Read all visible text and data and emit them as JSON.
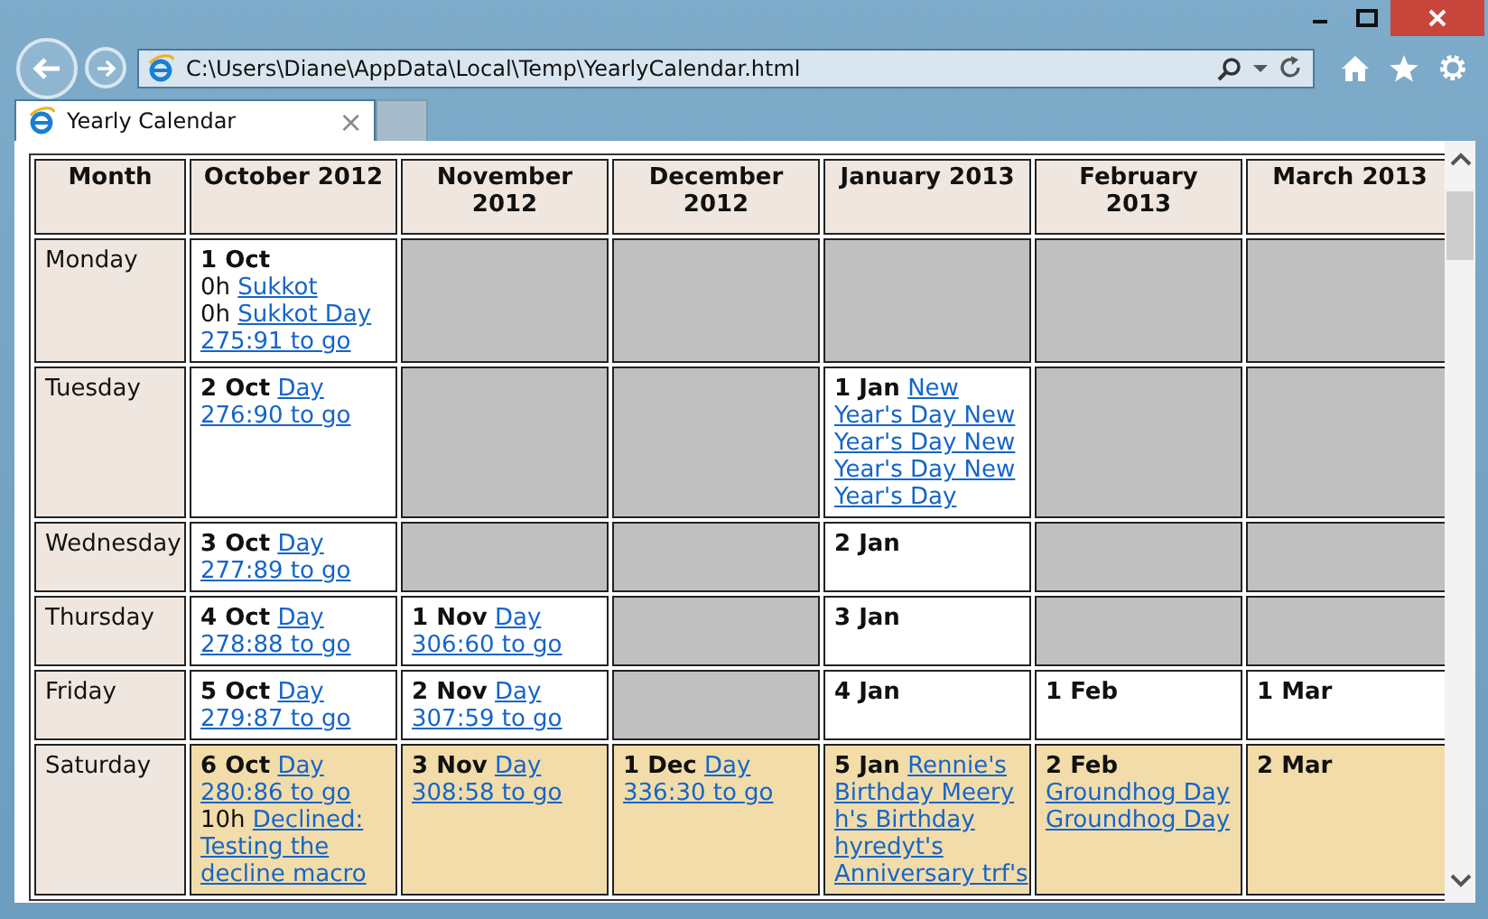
{
  "window": {
    "address": "C:\\Users\\Diane\\AppData\\Local\\Temp\\YearlyCalendar.html",
    "tabs": [
      {
        "title": "Yearly Calendar",
        "close": "×",
        "selected": true
      }
    ]
  },
  "table": {
    "columns": [
      "Month",
      "October 2012",
      "November 2012",
      "December 2012",
      "January 2013",
      "February 2013",
      "March 2013"
    ],
    "rows": [
      {
        "cells": [
          {
            "kind": "weekday",
            "text": "Monday"
          },
          {
            "kind": "day",
            "date": "1 Oct",
            "events": [
              {
                "kind": "timed",
                "time": "0h",
                "label": "Sukkot"
              },
              {
                "kind": "timed",
                "time": "0h",
                "label": "Sukkot Day"
              },
              {
                "kind": "countdown",
                "label": "275:91 to go"
              }
            ]
          },
          {
            "kind": "empty"
          },
          {
            "kind": "empty"
          },
          {
            "kind": "empty"
          },
          {
            "kind": "empty"
          },
          {
            "kind": "empty"
          }
        ]
      },
      {
        "cells": [
          {
            "kind": "weekday",
            "text": "Tuesday"
          },
          {
            "kind": "day",
            "date": "2 Oct",
            "events": [
              {
                "kind": "holiday",
                "label": "Day"
              },
              {
                "kind": "countdown",
                "label": "276:90 to go"
              }
            ]
          },
          {
            "kind": "empty"
          },
          {
            "kind": "empty"
          },
          {
            "kind": "day",
            "date": "1 Jan",
            "events": [
              {
                "kind": "holiday",
                "label": "New"
              },
              {
                "kind": "holiday",
                "label": "Year's Day New"
              },
              {
                "kind": "holiday",
                "label": "Year's Day New"
              },
              {
                "kind": "holiday",
                "label": "Year's Day New"
              },
              {
                "kind": "holiday",
                "label": "Year's Day"
              }
            ]
          },
          {
            "kind": "empty"
          },
          {
            "kind": "empty"
          }
        ]
      },
      {
        "cells": [
          {
            "kind": "weekday",
            "text": "Wednesday"
          },
          {
            "kind": "day",
            "date": "3 Oct",
            "events": [
              {
                "kind": "holiday",
                "label": "Day"
              },
              {
                "kind": "countdown",
                "label": "277:89 to go"
              }
            ]
          },
          {
            "kind": "empty"
          },
          {
            "kind": "empty"
          },
          {
            "kind": "day",
            "date": "2 Jan"
          },
          {
            "kind": "empty"
          },
          {
            "kind": "empty"
          }
        ]
      },
      {
        "cells": [
          {
            "kind": "weekday",
            "text": "Thursday"
          },
          {
            "kind": "day",
            "date": "4 Oct",
            "events": [
              {
                "kind": "holiday",
                "label": "Day"
              },
              {
                "kind": "countdown",
                "label": "278:88 to go"
              }
            ]
          },
          {
            "kind": "day",
            "date": "1 Nov",
            "events": [
              {
                "kind": "holiday",
                "label": "Day"
              },
              {
                "kind": "countdown",
                "label": "306:60 to go"
              }
            ]
          },
          {
            "kind": "empty"
          },
          {
            "kind": "day",
            "date": "3 Jan"
          },
          {
            "kind": "empty"
          },
          {
            "kind": "empty"
          }
        ]
      },
      {
        "cells": [
          {
            "kind": "weekday",
            "text": "Friday"
          },
          {
            "kind": "day",
            "date": "5 Oct",
            "events": [
              {
                "kind": "holiday",
                "label": "Day"
              },
              {
                "kind": "countdown",
                "label": "279:87 to go"
              }
            ]
          },
          {
            "kind": "day",
            "date": "2 Nov",
            "events": [
              {
                "kind": "holiday",
                "label": "Day"
              },
              {
                "kind": "countdown",
                "label": "307:59 to go"
              }
            ]
          },
          {
            "kind": "empty"
          },
          {
            "kind": "day",
            "date": "4 Jan"
          },
          {
            "kind": "day",
            "date": "1 Feb"
          },
          {
            "kind": "day",
            "date": "1 Mar"
          }
        ]
      },
      {
        "cells": [
          {
            "kind": "weekday",
            "text": "Saturday"
          },
          {
            "kind": "weekend",
            "date": "6 Oct",
            "events": [
              {
                "kind": "holiday",
                "label": "Day"
              },
              {
                "kind": "countdown",
                "label": "280:86 to go"
              },
              {
                "kind": "timed",
                "time": "10h",
                "label": "Declined:"
              },
              {
                "kind": "holiday",
                "label": "Testing the"
              },
              {
                "kind": "holiday",
                "label": "decline macro"
              }
            ]
          },
          {
            "kind": "weekend",
            "date": "3 Nov",
            "events": [
              {
                "kind": "holiday",
                "label": "Day"
              },
              {
                "kind": "countdown",
                "label": "308:58 to go"
              }
            ]
          },
          {
            "kind": "weekend",
            "date": "1 Dec",
            "events": [
              {
                "kind": "holiday",
                "label": "Day"
              },
              {
                "kind": "countdown",
                "label": "336:30 to go"
              }
            ]
          },
          {
            "kind": "weekend",
            "date": "5 Jan",
            "events": [
              {
                "kind": "holiday",
                "label": "Rennie's"
              },
              {
                "kind": "holiday",
                "label": "Birthday Meery"
              },
              {
                "kind": "holiday",
                "label": "h's Birthday"
              },
              {
                "kind": "holiday",
                "label": "hyredyt's"
              },
              {
                "kind": "holiday",
                "label": "Anniversary trf's"
              }
            ]
          },
          {
            "kind": "weekend",
            "date": "2 Feb",
            "events": [
              {
                "kind": "holiday",
                "label": "Groundhog Day"
              },
              {
                "kind": "holiday",
                "label": "Groundhog Day"
              }
            ]
          },
          {
            "kind": "weekend",
            "date": "2 Mar"
          }
        ]
      }
    ]
  }
}
